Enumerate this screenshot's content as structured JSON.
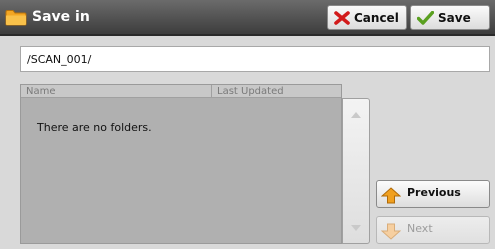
{
  "header": {
    "title": "Save in",
    "folder_icon": "folder-icon",
    "cancel_label": "Cancel",
    "cancel_icon": "red-x-icon",
    "save_label": "Save",
    "save_icon": "green-check-icon"
  },
  "path": {
    "value": "/SCAN_001/"
  },
  "list": {
    "columns": [
      "Name",
      "Last Updated"
    ],
    "empty_message": "There are no folders."
  },
  "scroll": {
    "up_icon": "scroll-up-arrow-icon",
    "down_icon": "scroll-down-arrow-icon"
  },
  "nav": {
    "previous_label": "Previous",
    "previous_icon": "up-arrow-icon",
    "next_label": "Next",
    "next_icon": "down-arrow-icon"
  },
  "colors": {
    "title_bar": "#4a4a4a",
    "panel": "#d9d9d9",
    "list_background": "#b0b0b0",
    "accent_orange": "#f0a020",
    "cancel_red": "#d21a1a",
    "save_green": "#5aa020"
  }
}
